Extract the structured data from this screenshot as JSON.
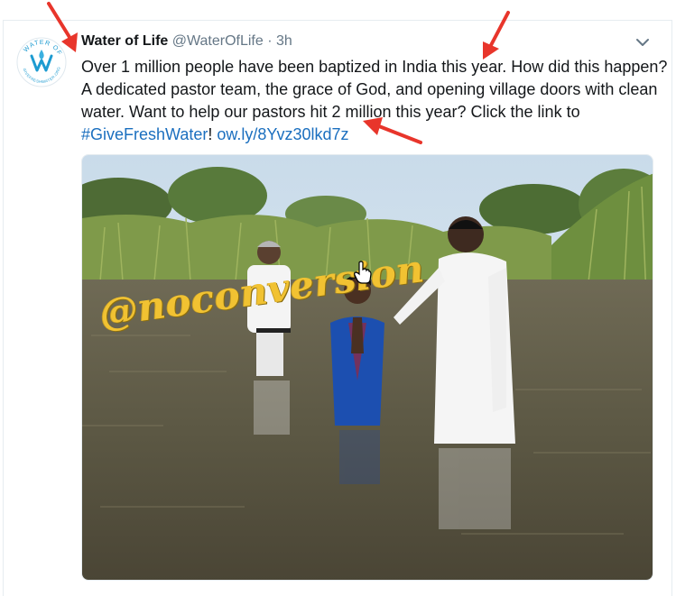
{
  "tweet": {
    "author_name": "Water of Life",
    "handle": "@WaterOfLife",
    "separator": "·",
    "time": "3h",
    "text_line_1": "Over 1 million people have been baptized in India this year. How did this happen?",
    "text_line_2": "A dedicated pastor team, the grace of God, and opening village doors with clean",
    "text_line_3": "water. Want to help our pastors hit 2 million this year? Click the link to",
    "hashtag": "#GiveFreshWater",
    "exclamation": "!",
    "link": "ow.ly/8Yvz30lkd7z"
  },
  "avatar": {
    "ring_text_top": "WATER OF",
    "ring_text_bottom": "GIVEFRESHWATER.ORG",
    "logo_letter": "W"
  },
  "media": {
    "watermark": "@noconversion",
    "description_icon": "photo"
  },
  "icons": {
    "caret": "chevron-down-icon",
    "cursor": "hand-pointer-icon",
    "arrow_color": "#e8352b"
  },
  "colors": {
    "link": "#1b6fbf",
    "secondary_text": "#657786",
    "brand_logo": "#1d9bd1",
    "watermark": "#f1c232"
  }
}
